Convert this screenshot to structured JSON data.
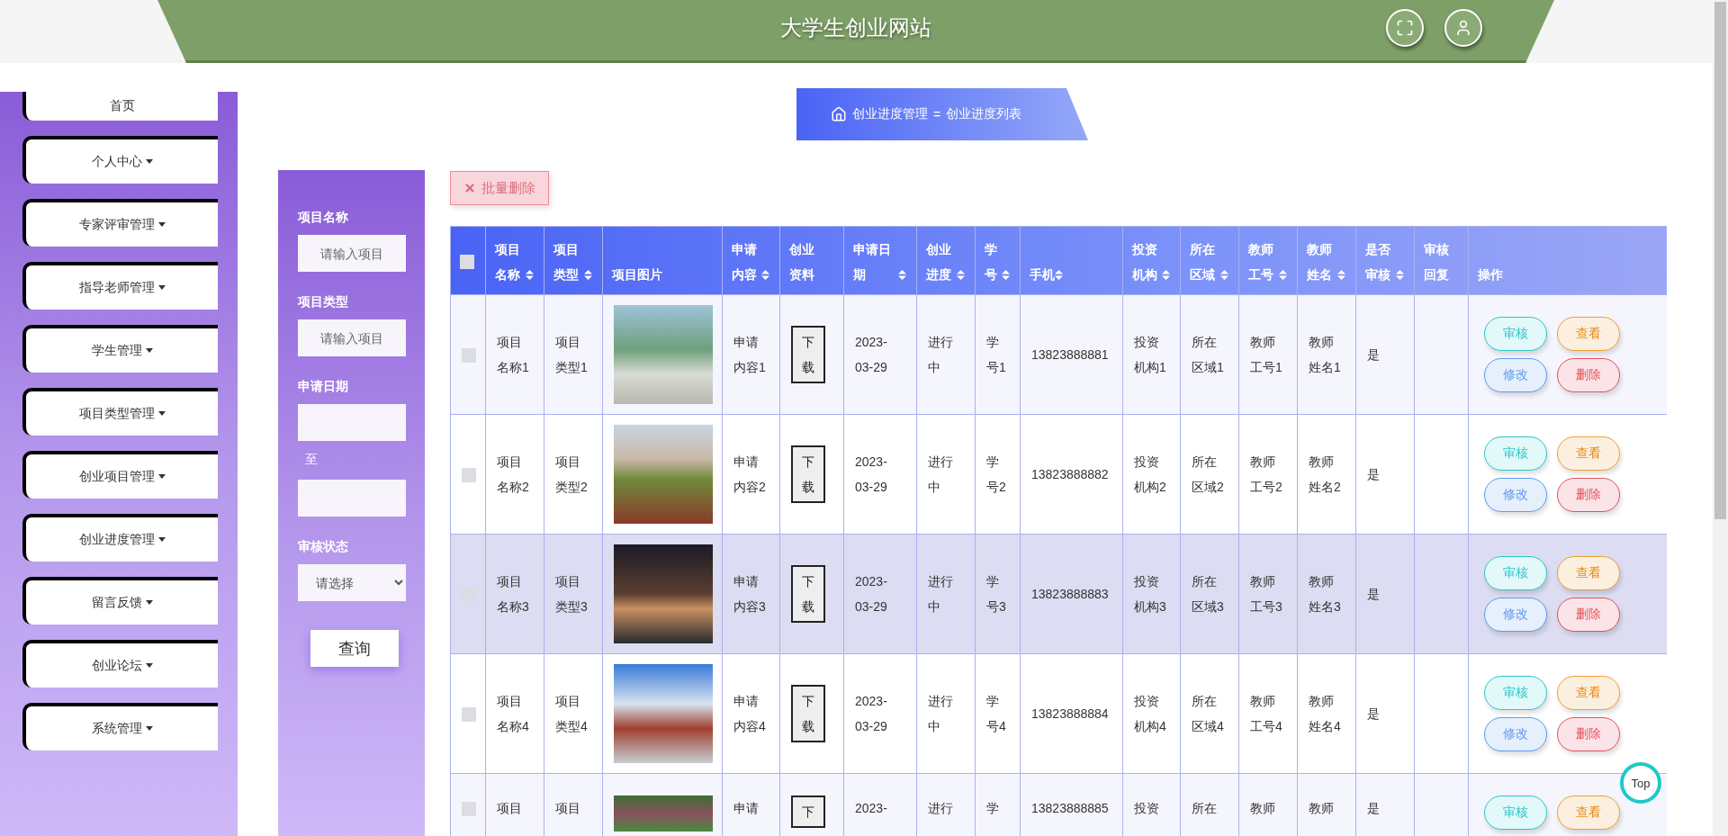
{
  "header": {
    "title": "大学生创业网站"
  },
  "sidebar": {
    "items": [
      {
        "label": "首页",
        "has_submenu": false
      },
      {
        "label": "个人中心",
        "has_submenu": true
      },
      {
        "label": "专家评审管理",
        "has_submenu": true
      },
      {
        "label": "指导老师管理",
        "has_submenu": true
      },
      {
        "label": "学生管理",
        "has_submenu": true
      },
      {
        "label": "项目类型管理",
        "has_submenu": true
      },
      {
        "label": "创业项目管理",
        "has_submenu": true
      },
      {
        "label": "创业进度管理",
        "has_submenu": true
      },
      {
        "label": "留言反馈",
        "has_submenu": true
      },
      {
        "label": "创业论坛",
        "has_submenu": true
      },
      {
        "label": "系统管理",
        "has_submenu": true
      }
    ]
  },
  "filters": {
    "fields": [
      {
        "kind": "text",
        "label": "项目名称",
        "placeholder": "请输入项目"
      },
      {
        "kind": "text",
        "label": "项目类型",
        "placeholder": "请输入项目"
      },
      {
        "kind": "daterange",
        "label": "申请日期",
        "separator": "至"
      },
      {
        "kind": "select",
        "label": "审核状态",
        "value": "请选择"
      }
    ],
    "submit": "查询"
  },
  "breadcrumb": {
    "parent": "创业进度管理",
    "separator": "=",
    "current": "创业进度列表"
  },
  "toolbar": {
    "batch_delete": "批量删除"
  },
  "table": {
    "columns": [
      {
        "kind": "checkbox",
        "checked": false
      },
      {
        "kind": "text",
        "label": "项目名称",
        "sortable": true
      },
      {
        "kind": "text",
        "label": "项目类型",
        "sortable": true
      },
      {
        "kind": "text",
        "label": "项目图片",
        "sortable": false
      },
      {
        "kind": "text",
        "label": "申请内容",
        "sortable": true
      },
      {
        "kind": "text",
        "label": "创业资料",
        "sortable": false
      },
      {
        "kind": "text",
        "label": "申请日期",
        "sortable": true
      },
      {
        "kind": "text",
        "label": "创业进度",
        "sortable": true
      },
      {
        "kind": "text",
        "label": "学号",
        "sortable": true
      },
      {
        "kind": "text",
        "label": "手机",
        "sortable": true
      },
      {
        "kind": "text",
        "label": "投资机构",
        "sortable": true
      },
      {
        "kind": "text",
        "label": "所在区域",
        "sortable": true
      },
      {
        "kind": "text",
        "label": "教师工号",
        "sortable": true
      },
      {
        "kind": "text",
        "label": "教师姓名",
        "sortable": true
      },
      {
        "kind": "text",
        "label": "是否审核",
        "sortable": true
      },
      {
        "kind": "text",
        "label": "审核回复",
        "sortable": false
      },
      {
        "kind": "text",
        "label": "操作",
        "sortable": false
      }
    ],
    "rows": [
      {
        "hovered": false,
        "cells": [
          {
            "kind": "checkbox",
            "checked": false
          },
          {
            "kind": "text",
            "text": "项目名称1"
          },
          {
            "kind": "text",
            "text": "项目类型1"
          },
          {
            "kind": "image"
          },
          {
            "kind": "text",
            "text": "申请内容1"
          },
          {
            "kind": "file",
            "text": "下载"
          },
          {
            "kind": "text",
            "text": "2023-03-29"
          },
          {
            "kind": "text",
            "text": "进行中"
          },
          {
            "kind": "text",
            "text": "学号1"
          },
          {
            "kind": "text",
            "text": "13823888881"
          },
          {
            "kind": "text",
            "text": "投资机构1"
          },
          {
            "kind": "text",
            "text": "所在区域1"
          },
          {
            "kind": "text",
            "text": "教师工号1"
          },
          {
            "kind": "text",
            "text": "教师姓名1"
          },
          {
            "kind": "text",
            "text": "是"
          },
          {
            "kind": "empty"
          },
          {
            "kind": "actions",
            "buttons": [
              {
                "kind": "audit",
                "label": "审核"
              },
              {
                "kind": "view",
                "label": "查看"
              },
              {
                "kind": "edit",
                "label": "修改"
              },
              {
                "kind": "delete",
                "label": "删除"
              }
            ]
          }
        ]
      },
      {
        "hovered": false,
        "cells": [
          {
            "kind": "checkbox",
            "checked": false
          },
          {
            "kind": "text",
            "text": "项目名称2"
          },
          {
            "kind": "text",
            "text": "项目类型2"
          },
          {
            "kind": "image"
          },
          {
            "kind": "text",
            "text": "申请内容2"
          },
          {
            "kind": "file",
            "text": "下载"
          },
          {
            "kind": "text",
            "text": "2023-03-29"
          },
          {
            "kind": "text",
            "text": "进行中"
          },
          {
            "kind": "text",
            "text": "学号2"
          },
          {
            "kind": "text",
            "text": "13823888882"
          },
          {
            "kind": "text",
            "text": "投资机构2"
          },
          {
            "kind": "text",
            "text": "所在区域2"
          },
          {
            "kind": "text",
            "text": "教师工号2"
          },
          {
            "kind": "text",
            "text": "教师姓名2"
          },
          {
            "kind": "text",
            "text": "是"
          },
          {
            "kind": "empty"
          },
          {
            "kind": "actions",
            "buttons": [
              {
                "kind": "audit",
                "label": "审核"
              },
              {
                "kind": "view",
                "label": "查看"
              },
              {
                "kind": "edit",
                "label": "修改"
              },
              {
                "kind": "delete",
                "label": "删除"
              }
            ]
          }
        ]
      },
      {
        "hovered": true,
        "cells": [
          {
            "kind": "checkbox",
            "checked": false
          },
          {
            "kind": "text",
            "text": "项目名称3"
          },
          {
            "kind": "text",
            "text": "项目类型3"
          },
          {
            "kind": "image"
          },
          {
            "kind": "text",
            "text": "申请内容3"
          },
          {
            "kind": "file",
            "text": "下载"
          },
          {
            "kind": "text",
            "text": "2023-03-29"
          },
          {
            "kind": "text",
            "text": "进行中"
          },
          {
            "kind": "text",
            "text": "学号3"
          },
          {
            "kind": "text",
            "text": "13823888883"
          },
          {
            "kind": "text",
            "text": "投资机构3"
          },
          {
            "kind": "text",
            "text": "所在区域3"
          },
          {
            "kind": "text",
            "text": "教师工号3"
          },
          {
            "kind": "text",
            "text": "教师姓名3"
          },
          {
            "kind": "text",
            "text": "是"
          },
          {
            "kind": "empty"
          },
          {
            "kind": "actions",
            "buttons": [
              {
                "kind": "audit",
                "label": "审核"
              },
              {
                "kind": "view",
                "label": "查看"
              },
              {
                "kind": "edit",
                "label": "修改"
              },
              {
                "kind": "delete",
                "label": "删除"
              }
            ]
          }
        ]
      },
      {
        "hovered": false,
        "cells": [
          {
            "kind": "checkbox",
            "checked": false
          },
          {
            "kind": "text",
            "text": "项目名称4"
          },
          {
            "kind": "text",
            "text": "项目类型4"
          },
          {
            "kind": "image"
          },
          {
            "kind": "text",
            "text": "申请内容4"
          },
          {
            "kind": "file",
            "text": "下载"
          },
          {
            "kind": "text",
            "text": "2023-03-29"
          },
          {
            "kind": "text",
            "text": "进行中"
          },
          {
            "kind": "text",
            "text": "学号4"
          },
          {
            "kind": "text",
            "text": "13823888884"
          },
          {
            "kind": "text",
            "text": "投资机构4"
          },
          {
            "kind": "text",
            "text": "所在区域4"
          },
          {
            "kind": "text",
            "text": "教师工号4"
          },
          {
            "kind": "text",
            "text": "教师姓名4"
          },
          {
            "kind": "text",
            "text": "是"
          },
          {
            "kind": "empty"
          },
          {
            "kind": "actions",
            "buttons": [
              {
                "kind": "audit",
                "label": "审核"
              },
              {
                "kind": "view",
                "label": "查看"
              },
              {
                "kind": "edit",
                "label": "修改"
              },
              {
                "kind": "delete",
                "label": "删除"
              }
            ]
          }
        ]
      },
      {
        "hovered": false,
        "cells": [
          {
            "kind": "checkbox",
            "checked": false
          },
          {
            "kind": "text",
            "text": "项目"
          },
          {
            "kind": "text",
            "text": "项目"
          },
          {
            "kind": "image"
          },
          {
            "kind": "text",
            "text": "申请"
          },
          {
            "kind": "file",
            "text": "下"
          },
          {
            "kind": "text",
            "text": "2023-"
          },
          {
            "kind": "text",
            "text": "进行"
          },
          {
            "kind": "text",
            "text": "学"
          },
          {
            "kind": "text",
            "text": "13823888885"
          },
          {
            "kind": "text",
            "text": "投资"
          },
          {
            "kind": "text",
            "text": "所在"
          },
          {
            "kind": "text",
            "text": "教师"
          },
          {
            "kind": "text",
            "text": "教师"
          },
          {
            "kind": "text",
            "text": "是"
          },
          {
            "kind": "empty"
          },
          {
            "kind": "actions",
            "buttons": [
              {
                "kind": "audit",
                "label": "审核"
              },
              {
                "kind": "view",
                "label": "查看"
              }
            ]
          }
        ]
      }
    ]
  },
  "back_to_top": "Top"
}
